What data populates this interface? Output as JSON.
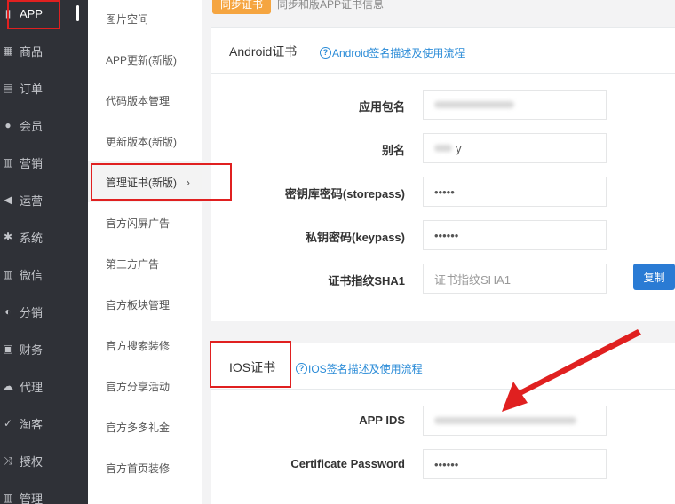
{
  "nav": {
    "items": [
      {
        "label": "APP",
        "icon": "app-icon",
        "glyph": "▮"
      },
      {
        "label": "商品",
        "icon": "goods-icon",
        "glyph": "▦"
      },
      {
        "label": "订单",
        "icon": "order-icon",
        "glyph": "▤"
      },
      {
        "label": "会员",
        "icon": "member-icon",
        "glyph": "●"
      },
      {
        "label": "营销",
        "icon": "marketing-icon",
        "glyph": "▥"
      },
      {
        "label": "运营",
        "icon": "operation-icon",
        "glyph": "◀"
      },
      {
        "label": "系统",
        "icon": "system-icon",
        "glyph": "✱"
      },
      {
        "label": "微信",
        "icon": "wechat-icon",
        "glyph": "▥"
      },
      {
        "label": "分销",
        "icon": "distribution-icon",
        "glyph": "◐"
      },
      {
        "label": "财务",
        "icon": "finance-icon",
        "glyph": "▣"
      },
      {
        "label": "代理",
        "icon": "agent-icon",
        "glyph": "☁"
      },
      {
        "label": "淘客",
        "icon": "taoke-icon",
        "glyph": "✓"
      },
      {
        "label": "授权",
        "icon": "authorize-icon",
        "glyph": "⤨"
      },
      {
        "label": "管理",
        "icon": "manage-icon",
        "glyph": "▥"
      }
    ]
  },
  "submenu": {
    "items": [
      {
        "label": "图片空间"
      },
      {
        "label": "APP更新(新版)"
      },
      {
        "label": "代码版本管理"
      },
      {
        "label": "更新版本(新版)"
      },
      {
        "label": "管理证书(新版)",
        "arrow": "›"
      },
      {
        "label": "官方闪屏广告"
      },
      {
        "label": "第三方广告"
      },
      {
        "label": "官方板块管理"
      },
      {
        "label": "官方搜索装修"
      },
      {
        "label": "官方分享活动"
      },
      {
        "label": "官方多多礼金"
      },
      {
        "label": "官方首页装修"
      }
    ]
  },
  "topbar": {
    "sync_button": "同步证书",
    "sync_text": "同步和版APP证书信息"
  },
  "android": {
    "title": "Android证书",
    "help_icon": "?",
    "help": "Android签名描述及使用流程",
    "fields": [
      {
        "label": "应用包名",
        "value": ""
      },
      {
        "label": "别名",
        "value": "y"
      },
      {
        "label": "密钥库密码(storepass)",
        "value": "•••••"
      },
      {
        "label": "私钥密码(keypass)",
        "value": "••••••"
      },
      {
        "label": "证书指纹SHA1",
        "placeholder": "证书指纹SHA1"
      }
    ],
    "copy_button": "复制"
  },
  "ios": {
    "title": "IOS证书",
    "help_icon": "?",
    "help": "IOS签名描述及使用流程",
    "fields": [
      {
        "label": "APP IDS",
        "value": ""
      },
      {
        "label": "Certificate Password",
        "value": "••••••"
      }
    ]
  },
  "colors": {
    "nav_bg": "#2f3137",
    "accent_blue": "#2a7bd4",
    "link_blue": "#2a8bd7",
    "sync_orange": "#f5a540",
    "annotation_red": "#e02020"
  }
}
